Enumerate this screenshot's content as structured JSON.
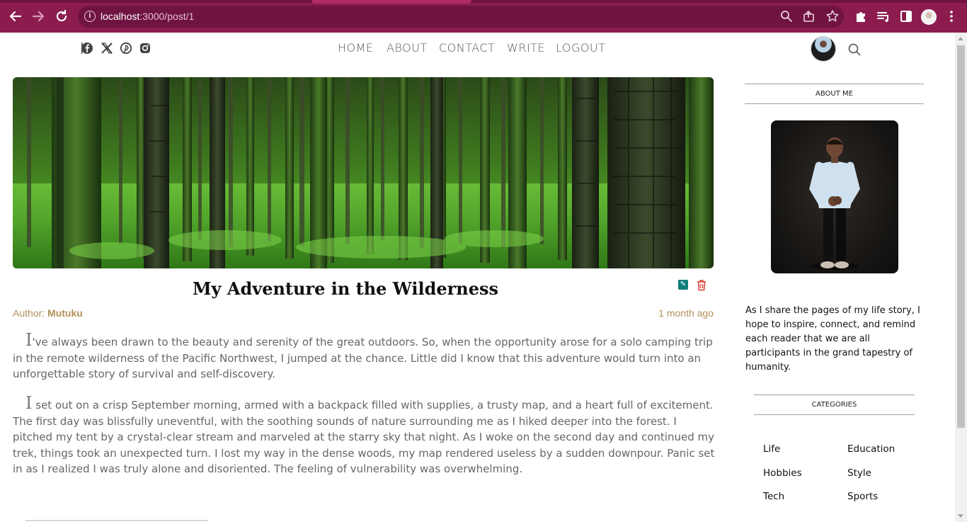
{
  "browser": {
    "url_host": "localhost",
    "url_rest": ":3000/post/1",
    "icons": {
      "back": "arrow-left-icon",
      "forward": "arrow-right-icon",
      "reload": "reload-icon",
      "site_info": "info-icon",
      "zoom": "zoom-icon",
      "share": "share-icon",
      "bookmark": "star-icon",
      "extensions": "puzzle-icon",
      "media": "media-queue-icon",
      "side_panel": "side-panel-icon",
      "profile": "profile-avatar",
      "menu": "kebab-menu-icon"
    },
    "colors": {
      "frame": "#8c1c4e",
      "omnibox": "#6f1440"
    }
  },
  "header": {
    "social": [
      "facebook-icon",
      "x-icon",
      "pinterest-icon",
      "instagram-icon"
    ],
    "nav": {
      "home": "HOME",
      "about": "ABOUT",
      "contact": "CONTACT",
      "write": "WRITE",
      "logout": "LOGOUT"
    }
  },
  "post": {
    "title": "My Adventure in the Wilderness",
    "author_label": "Author: ",
    "author_name": "Mutuku",
    "time_ago": "1 month ago",
    "paragraph1_dropcap": "I",
    "paragraph1": "'ve always been drawn to the beauty and serenity of the great outdoors. So, when the opportunity arose for a solo camping trip in the remote wilderness of the Pacific Northwest, I jumped at the chance. Little did I know that this adventure would turn into an unforgettable story of survival and self-discovery.",
    "paragraph2_dropcap": "I",
    "paragraph2": " set out on a crisp September morning, armed with a backpack filled with supplies, a trusty map, and a heart full of excitement. The first day was blissfully uneventful, with the soothing sounds of nature surrounding me as I hiked deeper into the forest. I pitched my tent by a crystal-clear stream and marveled at the starry sky that night. As I woke on the second day and continued my trek, things took an unexpected turn. I lost my way in the dense woods, my map rendered useless by a sudden downpour. Panic set in as I realized I was truly alone and disoriented. The feeling of vulnerability was overwhelming.",
    "accent_color": "#b39059"
  },
  "sidebar": {
    "about_title": "ABOUT ME",
    "about_text": "As I share the pages of my life story, I hope to inspire, connect, and remind each reader that we are all participants in the grand tapestry of humanity.",
    "categories_title": "CATEGORIES",
    "categories": [
      "Life",
      "Education",
      "Hobbies",
      "Style",
      "Tech",
      "Sports"
    ]
  }
}
